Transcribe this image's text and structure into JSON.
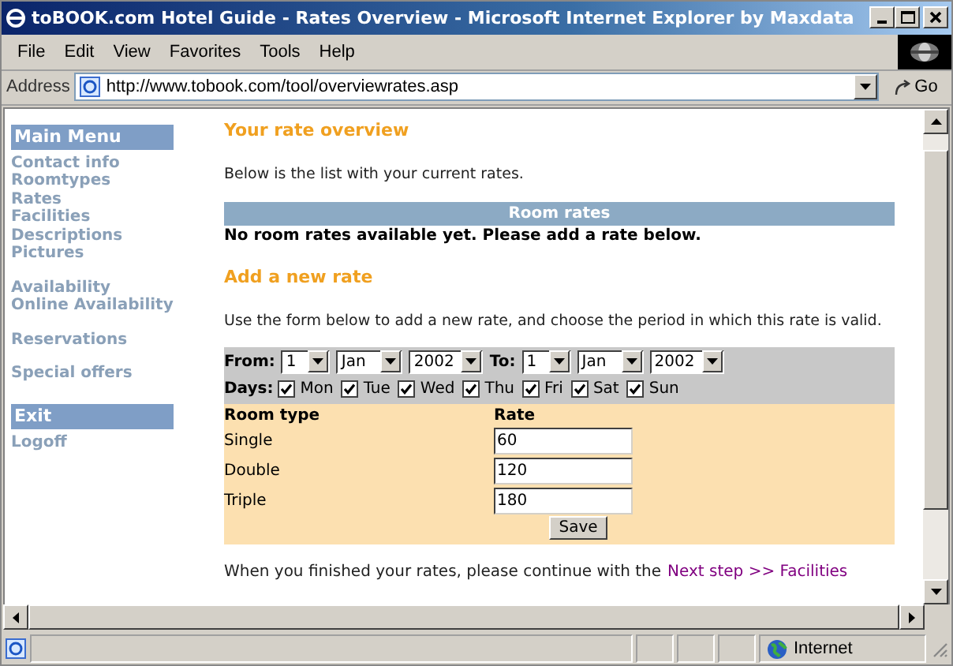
{
  "window": {
    "title": "toBOOK.com Hotel Guide - Rates Overview - Microsoft Internet Explorer by Maxdata"
  },
  "menu": [
    "File",
    "Edit",
    "View",
    "Favorites",
    "Tools",
    "Help"
  ],
  "address": {
    "label": "Address",
    "url": "http://www.tobook.com/tool/overviewrates.asp",
    "go": "Go"
  },
  "sidebar": {
    "sections": [
      {
        "heading": "Main Menu",
        "groups": [
          [
            "Contact info",
            "Roomtypes",
            "Rates",
            "Facilities",
            "Descriptions",
            "Pictures"
          ],
          [
            "Availability",
            "Online Availability"
          ],
          [
            "Reservations"
          ],
          [
            "Special offers"
          ]
        ]
      },
      {
        "heading": "Exit",
        "groups": [
          [
            "Logoff"
          ]
        ]
      }
    ]
  },
  "main": {
    "overview_heading": "Your rate overview",
    "overview_intro": "Below is the list with your current rates.",
    "table_header": "Room rates",
    "empty_message": "No room rates available yet. Please add a rate below.",
    "add_heading": "Add a new rate",
    "add_intro": "Use the form below to add a new rate, and choose the period in which this rate is valid.",
    "form": {
      "from_label": "From:",
      "from": [
        "1",
        "Jan",
        "2002"
      ],
      "to_label": "To:",
      "to": [
        "1",
        "Jan",
        "2002"
      ],
      "days_label": "Days:",
      "days": [
        {
          "label": "Mon",
          "checked": true
        },
        {
          "label": "Tue",
          "checked": true
        },
        {
          "label": "Wed",
          "checked": true
        },
        {
          "label": "Thu",
          "checked": true
        },
        {
          "label": "Fri",
          "checked": true
        },
        {
          "label": "Sat",
          "checked": true
        },
        {
          "label": "Sun",
          "checked": true
        }
      ],
      "columns": [
        "Room type",
        "Rate"
      ],
      "rows": [
        {
          "room": "Single",
          "rate": "60"
        },
        {
          "room": "Double",
          "rate": "120"
        },
        {
          "room": "Triple",
          "rate": "180"
        }
      ],
      "save": "Save"
    },
    "footer_text": "When you finished your rates, please continue with the",
    "footer_link": "Next step >> Facilities"
  },
  "status_bar": {
    "zone": "Internet"
  }
}
